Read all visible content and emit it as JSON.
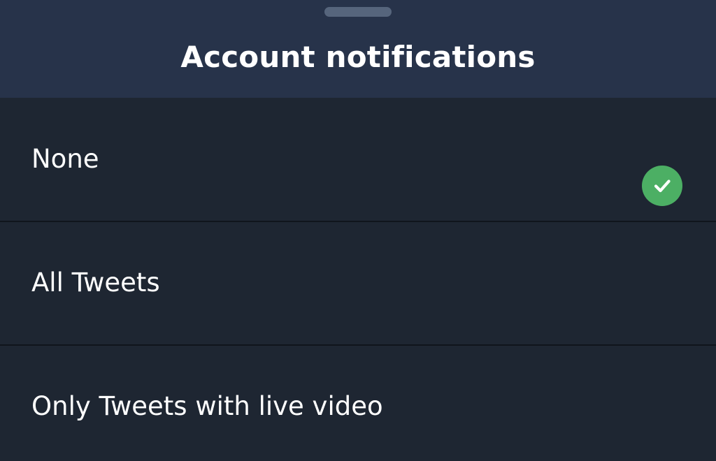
{
  "header": {
    "title": "Account notifications"
  },
  "options": [
    {
      "label": "None",
      "selected": false
    },
    {
      "label": "All Tweets",
      "selected": true
    },
    {
      "label": "Only Tweets with live video",
      "selected": false
    }
  ],
  "icons": {
    "selected": "checkmark-icon",
    "grabber": "drag-handle-icon"
  },
  "colors": {
    "background": "#1e2632",
    "header": "#27334a",
    "check": "#4caf64",
    "text": "#ffffff"
  }
}
